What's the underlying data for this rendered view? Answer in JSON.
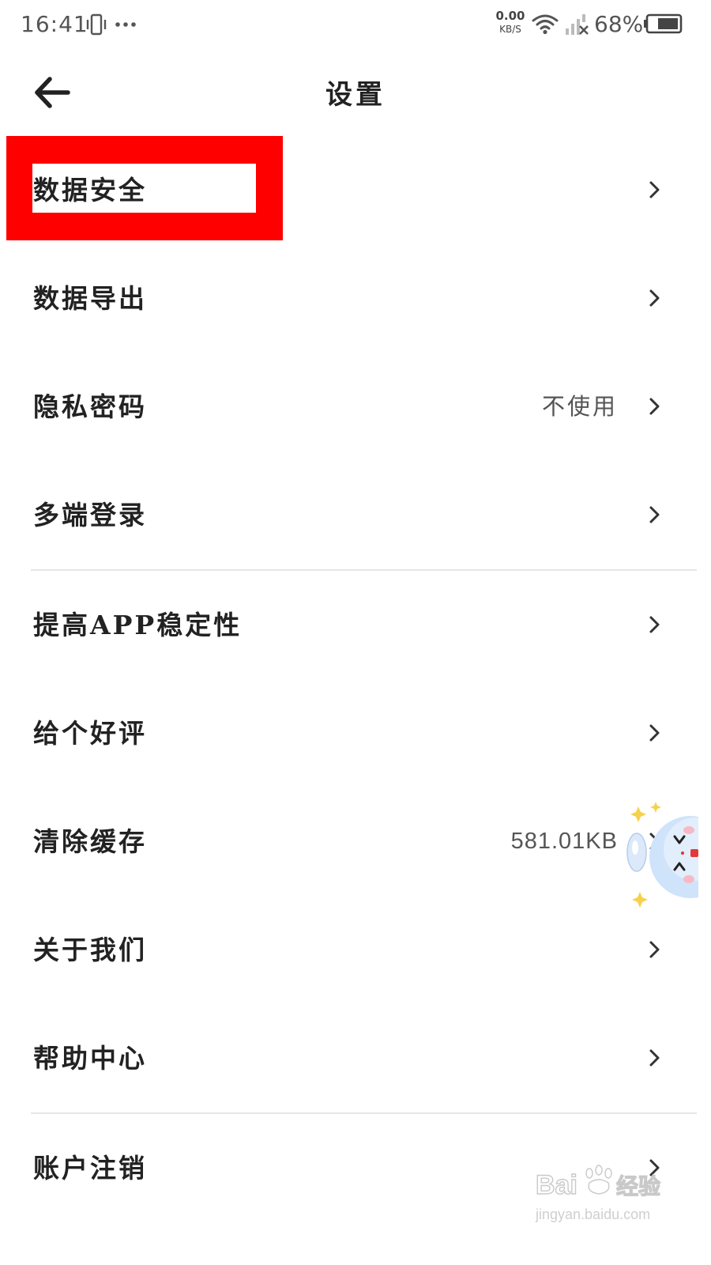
{
  "status_bar": {
    "time": "16:41",
    "net_speed_value": "0.00",
    "net_speed_unit": "KB/S",
    "battery_percent": "68%"
  },
  "header": {
    "back_icon": "arrow-left-icon",
    "title": "设置"
  },
  "settings": {
    "items": [
      {
        "label": "数据安全",
        "value": ""
      },
      {
        "label": "数据导出",
        "value": ""
      },
      {
        "label": "隐私密码",
        "value": "不使用"
      },
      {
        "label": "多端登录",
        "value": ""
      },
      {
        "label": "提高APP稳定性",
        "value": ""
      },
      {
        "label": "给个好评",
        "value": ""
      },
      {
        "label": "清除缓存",
        "value": "581.01KB"
      },
      {
        "label": "关于我们",
        "value": ""
      },
      {
        "label": "帮助中心",
        "value": ""
      },
      {
        "label": "账户注销",
        "value": ""
      }
    ],
    "row_icon": "chevron-right-icon"
  },
  "watermark": {
    "brand": "Baidu经验",
    "url": "jingyan.baidu.com"
  },
  "colors": {
    "highlight": "#ff0000",
    "text": "#222222",
    "secondary_text": "#555555",
    "divider": "#e6e6e6",
    "background": "#ffffff"
  }
}
